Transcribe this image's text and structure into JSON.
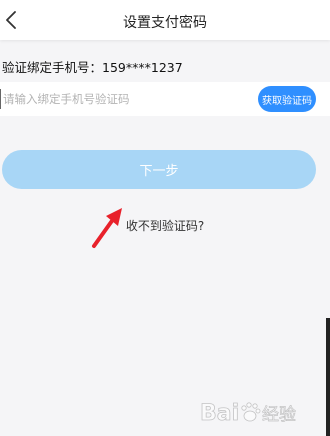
{
  "header": {
    "title": "设置支付密码",
    "back_icon": "chevron-left-icon"
  },
  "phone": {
    "label": "验证绑定手机号：",
    "number": "159****1237"
  },
  "code_field": {
    "placeholder": "请输入绑定手机号验证码",
    "value": ""
  },
  "get_code_button": {
    "label": "获取验证码"
  },
  "next_button": {
    "label": "下一步"
  },
  "no_code_link": {
    "label": "收不到验证码?"
  },
  "watermark": {
    "text": "Bai 经验"
  },
  "colors": {
    "accent": "#2f8fff",
    "next_disabled": "#a8d6f6",
    "arrow": "#e8212b",
    "background": "#f5f5f7"
  }
}
